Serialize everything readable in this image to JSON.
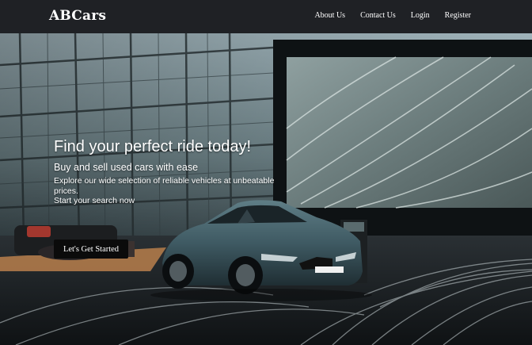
{
  "brand": {
    "name": "ABCars"
  },
  "nav": {
    "items": [
      {
        "label": "About Us"
      },
      {
        "label": "Contact Us"
      },
      {
        "label": "Login"
      },
      {
        "label": "Register"
      }
    ]
  },
  "hero": {
    "title": "Find your perfect ride today!",
    "subtitle": "Buy and sell used cars with ease",
    "description_line1": "Explore our wide selection of reliable vehicles at unbeatable prices.",
    "description_line2": "Start your search now",
    "cta_label": "Let's Get Started"
  },
  "colors": {
    "navbar_bg": "#1f2125",
    "cta_bg": "#0b0b0b",
    "text": "#ffffff",
    "car_body": "#3f5a63"
  }
}
